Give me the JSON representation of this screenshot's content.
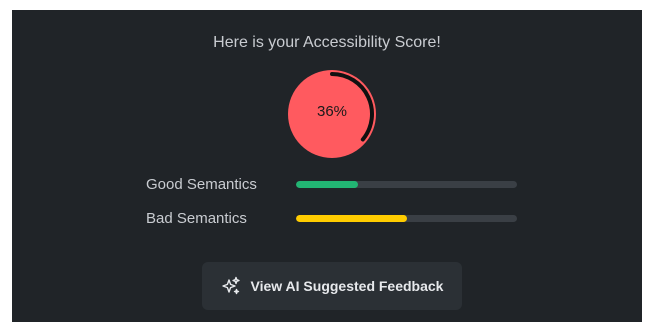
{
  "heading": "Here is your Accessibility Score!",
  "score": {
    "label": "36%",
    "value": 0.36,
    "color": "#ff5a5f",
    "arc_color": "#111111"
  },
  "metrics": [
    {
      "label": "Good Semantics",
      "value": 0.28,
      "color": "#22b573"
    },
    {
      "label": "Bad Semantics",
      "value": 0.5,
      "color": "#ffcc00"
    }
  ],
  "feedback_button": {
    "label": "View AI Suggested Feedback",
    "icon": "sparkles-icon"
  }
}
